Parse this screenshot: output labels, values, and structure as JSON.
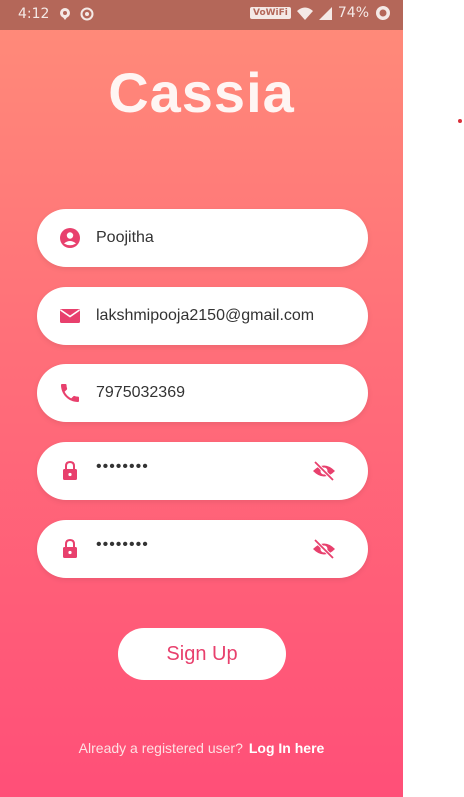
{
  "status_bar": {
    "time": "4:12",
    "network_badge": "VoWiFi",
    "battery": "74%",
    "icons": [
      "location-icon",
      "sync-icon",
      "wifi-icon",
      "signal-icon",
      "battery-icon"
    ]
  },
  "app": {
    "title": "Cassia"
  },
  "form": {
    "name_value": "Poojitha",
    "email_value": "lakshmipooja2150@gmail.com",
    "phone_value": "7975032369",
    "password_value": "••••••••",
    "confirm_password_value": "••••••••"
  },
  "actions": {
    "signup_label": "Sign Up"
  },
  "footer": {
    "prompt": "Already a registered user?",
    "login_label": "Log In here"
  },
  "colors": {
    "gradient_top": "#ff8c79",
    "gradient_bottom": "#ff4f78",
    "accent": "#e8406d",
    "status_bar": "#b46759"
  }
}
